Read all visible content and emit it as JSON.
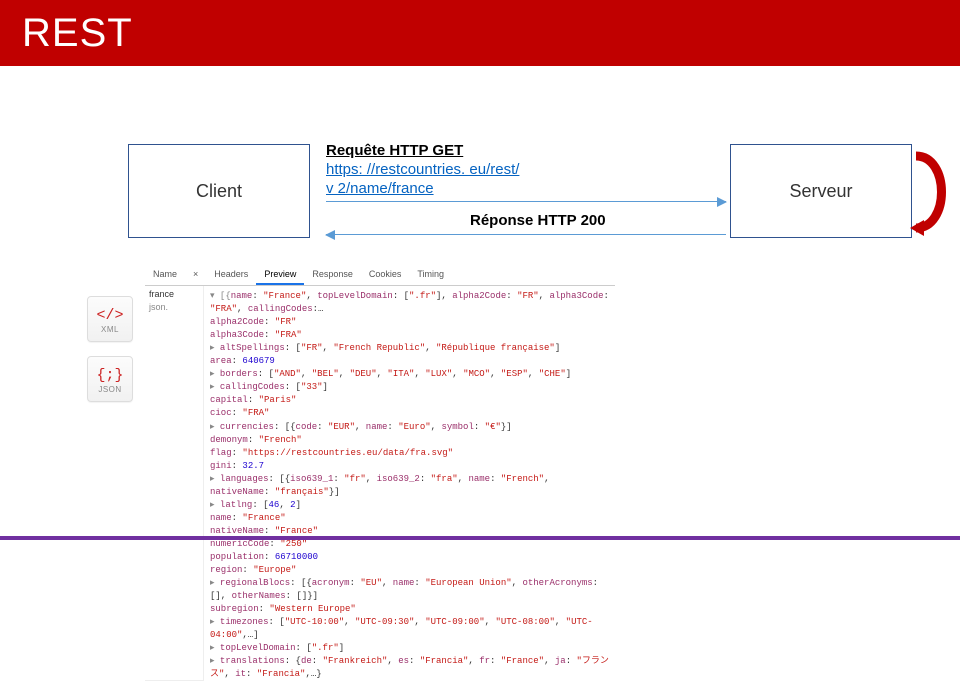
{
  "title": "REST",
  "client_label": "Client",
  "server_label": "Serveur",
  "request_label": "Requête HTTP GET",
  "request_url_1": "https: //restcountries. eu/rest/",
  "request_url_2": "v 2/name/france",
  "response_label": "Réponse HTTP 200",
  "icons": {
    "xml_glyph": "</>",
    "xml_label": "XML",
    "json_glyph": "{;}",
    "json_label": "JSON"
  },
  "devtools": {
    "tabs": [
      "Name",
      "×",
      "Headers",
      "Preview",
      "Response",
      "Cookies",
      "Timing"
    ],
    "selected_tab": "Preview",
    "list_items": [
      "france",
      "json."
    ],
    "json_lines": [
      {
        "pre": "▾ [{",
        "body": [
          [
            "k",
            "name"
          ],
          ": ",
          [
            "s",
            "\"France\""
          ],
          ", ",
          [
            "k",
            "topLevelDomain"
          ],
          ": [",
          [
            "s",
            "\".fr\""
          ],
          "], ",
          [
            "k",
            "alpha2Code"
          ],
          ": ",
          [
            "s",
            "\"FR\""
          ],
          ", ",
          [
            "k",
            "alpha3Code"
          ],
          ": ",
          [
            "s",
            "\"FRA\""
          ],
          ", ",
          [
            "k",
            "callingCodes"
          ],
          ":…"
        ]
      },
      {
        "pre": "    ",
        "body": [
          [
            "k",
            "alpha2Code"
          ],
          ": ",
          [
            "s",
            "\"FR\""
          ]
        ]
      },
      {
        "pre": "    ",
        "body": [
          [
            "k",
            "alpha3Code"
          ],
          ": ",
          [
            "s",
            "\"FRA\""
          ]
        ]
      },
      {
        "pre": "  ▸ ",
        "body": [
          [
            "k",
            "altSpellings"
          ],
          ": [",
          [
            "s",
            "\"FR\""
          ],
          ", ",
          [
            "s",
            "\"French Republic\""
          ],
          ", ",
          [
            "s",
            "\"République française\""
          ],
          "]"
        ]
      },
      {
        "pre": "    ",
        "body": [
          [
            "k",
            "area"
          ],
          ": ",
          [
            "n",
            "640679"
          ]
        ]
      },
      {
        "pre": "  ▸ ",
        "body": [
          [
            "k",
            "borders"
          ],
          ": [",
          [
            "s",
            "\"AND\""
          ],
          ", ",
          [
            "s",
            "\"BEL\""
          ],
          ", ",
          [
            "s",
            "\"DEU\""
          ],
          ", ",
          [
            "s",
            "\"ITA\""
          ],
          ", ",
          [
            "s",
            "\"LUX\""
          ],
          ", ",
          [
            "s",
            "\"MCO\""
          ],
          ", ",
          [
            "s",
            "\"ESP\""
          ],
          ", ",
          [
            "s",
            "\"CHE\""
          ],
          "]"
        ]
      },
      {
        "pre": "  ▸ ",
        "body": [
          [
            "k",
            "callingCodes"
          ],
          ": [",
          [
            "s",
            "\"33\""
          ],
          "]"
        ]
      },
      {
        "pre": "    ",
        "body": [
          [
            "k",
            "capital"
          ],
          ": ",
          [
            "s",
            "\"Paris\""
          ]
        ]
      },
      {
        "pre": "    ",
        "body": [
          [
            "k",
            "cioc"
          ],
          ": ",
          [
            "s",
            "\"FRA\""
          ]
        ]
      },
      {
        "pre": "  ▸ ",
        "body": [
          [
            "k",
            "currencies"
          ],
          ": [{",
          [
            "k",
            "code"
          ],
          ": ",
          [
            "s",
            "\"EUR\""
          ],
          ", ",
          [
            "k",
            "name"
          ],
          ": ",
          [
            "s",
            "\"Euro\""
          ],
          ", ",
          [
            "k",
            "symbol"
          ],
          ": ",
          [
            "s",
            "\"€\""
          ],
          "}]"
        ]
      },
      {
        "pre": "    ",
        "body": [
          [
            "k",
            "demonym"
          ],
          ": ",
          [
            "s",
            "\"French\""
          ]
        ]
      },
      {
        "pre": "    ",
        "body": [
          [
            "k",
            "flag"
          ],
          ": ",
          [
            "s",
            "\"https://restcountries.eu/data/fra.svg\""
          ]
        ]
      },
      {
        "pre": "    ",
        "body": [
          [
            "k",
            "gini"
          ],
          ": ",
          [
            "n",
            "32.7"
          ]
        ]
      },
      {
        "pre": "  ▸ ",
        "body": [
          [
            "k",
            "languages"
          ],
          ": [{",
          [
            "k",
            "iso639_1"
          ],
          ": ",
          [
            "s",
            "\"fr\""
          ],
          ", ",
          [
            "k",
            "iso639_2"
          ],
          ": ",
          [
            "s",
            "\"fra\""
          ],
          ", ",
          [
            "k",
            "name"
          ],
          ": ",
          [
            "s",
            "\"French\""
          ],
          ", ",
          [
            "k",
            "nativeName"
          ],
          ": ",
          [
            "s",
            "\"français\""
          ],
          "}]"
        ]
      },
      {
        "pre": "  ▸ ",
        "body": [
          [
            "k",
            "latlng"
          ],
          ": [",
          [
            "n",
            "46"
          ],
          ", ",
          [
            "n",
            "2"
          ],
          "]"
        ]
      },
      {
        "pre": "    ",
        "body": [
          [
            "k",
            "name"
          ],
          ": ",
          [
            "s",
            "\"France\""
          ]
        ]
      },
      {
        "pre": "    ",
        "body": [
          [
            "k",
            "nativeName"
          ],
          ": ",
          [
            "s",
            "\"France\""
          ]
        ]
      },
      {
        "pre": "    ",
        "body": [
          [
            "k",
            "numericCode"
          ],
          ": ",
          [
            "s",
            "\"250\""
          ]
        ]
      },
      {
        "pre": "    ",
        "body": [
          [
            "k",
            "population"
          ],
          ": ",
          [
            "n",
            "66710000"
          ]
        ]
      },
      {
        "pre": "    ",
        "body": [
          [
            "k",
            "region"
          ],
          ": ",
          [
            "s",
            "\"Europe\""
          ]
        ]
      },
      {
        "pre": "  ▸ ",
        "body": [
          [
            "k",
            "regionalBlocs"
          ],
          ": [{",
          [
            "k",
            "acronym"
          ],
          ": ",
          [
            "s",
            "\"EU\""
          ],
          ", ",
          [
            "k",
            "name"
          ],
          ": ",
          [
            "s",
            "\"European Union\""
          ],
          ", ",
          [
            "k",
            "otherAcronyms"
          ],
          ": [], ",
          [
            "k",
            "otherNames"
          ],
          ": []}]"
        ]
      },
      {
        "pre": "    ",
        "body": [
          [
            "k",
            "subregion"
          ],
          ": ",
          [
            "s",
            "\"Western Europe\""
          ]
        ]
      },
      {
        "pre": "  ▸ ",
        "body": [
          [
            "k",
            "timezones"
          ],
          ": [",
          [
            "s",
            "\"UTC-10:00\""
          ],
          ", ",
          [
            "s",
            "\"UTC-09:30\""
          ],
          ", ",
          [
            "s",
            "\"UTC-09:00\""
          ],
          ", ",
          [
            "s",
            "\"UTC-08:00\""
          ],
          ", ",
          [
            "s",
            "\"UTC-04:00\""
          ],
          ",…]"
        ]
      },
      {
        "pre": "  ▸ ",
        "body": [
          [
            "k",
            "topLevelDomain"
          ],
          ": [",
          [
            "s",
            "\".fr\""
          ],
          "]"
        ]
      },
      {
        "pre": "  ▸ ",
        "body": [
          [
            "k",
            "translations"
          ],
          ": {",
          [
            "k",
            "de"
          ],
          ": ",
          [
            "s",
            "\"Frankreich\""
          ],
          ", ",
          [
            "k",
            "es"
          ],
          ": ",
          [
            "s",
            "\"Francia\""
          ],
          ", ",
          [
            "k",
            "fr"
          ],
          ": ",
          [
            "s",
            "\"France\""
          ],
          ", ",
          [
            "k",
            "ja"
          ],
          ": ",
          [
            "s",
            "\"フランス\""
          ],
          ", ",
          [
            "k",
            "it"
          ],
          ": ",
          [
            "s",
            "\"Francia\""
          ],
          ",…}"
        ]
      }
    ]
  }
}
